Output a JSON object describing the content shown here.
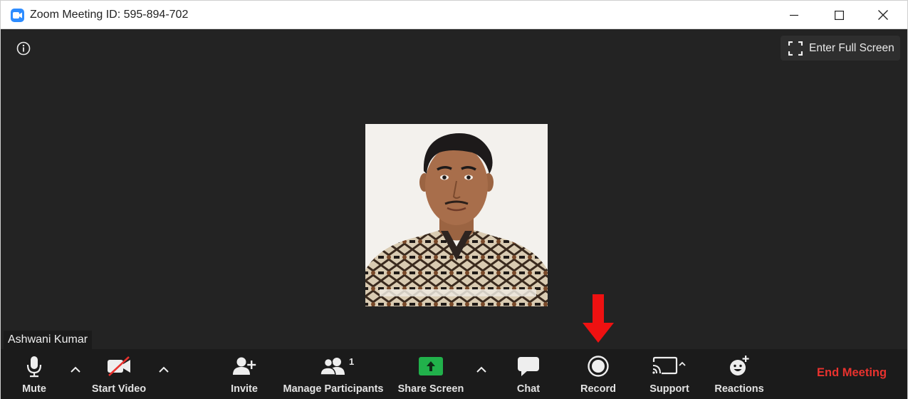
{
  "window": {
    "title": "Zoom Meeting ID: 595-894-702"
  },
  "stage": {
    "fullscreen_label": "Enter Full Screen",
    "participant_name": "Ashwani Kumar"
  },
  "toolbar": {
    "mute_label": "Mute",
    "video_label": "Start Video",
    "invite_label": "Invite",
    "participants_label": "Manage Participants",
    "participants_count": "1",
    "share_label": "Share Screen",
    "chat_label": "Chat",
    "record_label": "Record",
    "support_label": "Support",
    "reactions_label": "Reactions",
    "end_label": "End Meeting"
  },
  "colors": {
    "accent": "#2d8cff",
    "share_green": "#21b14b",
    "end_red": "#e8322e",
    "annotation_red": "#ee1111",
    "stage_bg": "#232323",
    "toolbar_bg": "#1b1b1b"
  },
  "icons": {
    "app": "zoom-logo-icon",
    "info": "info-icon",
    "fullscreen": "expand-corners-icon",
    "mute": "microphone-icon",
    "video": "video-off-icon",
    "invite": "add-person-icon",
    "participants": "people-icon",
    "share": "share-up-arrow-icon",
    "chat": "speech-bubble-icon",
    "record": "record-circle-icon",
    "support": "cast-screen-icon",
    "reactions": "add-emoji-icon"
  }
}
